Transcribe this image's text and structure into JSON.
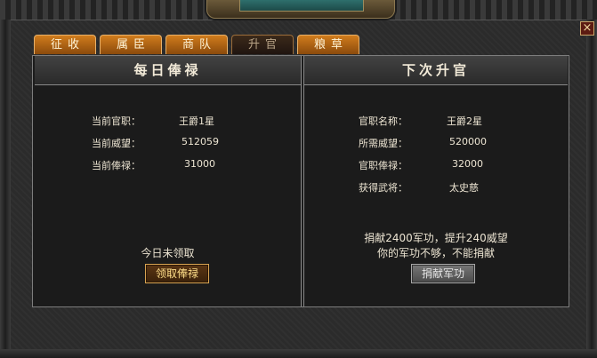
{
  "tabs": [
    {
      "label": "征收",
      "active": false
    },
    {
      "label": "属臣",
      "active": false
    },
    {
      "label": "商队",
      "active": false
    },
    {
      "label": "升官",
      "active": true
    },
    {
      "label": "粮草",
      "active": false
    }
  ],
  "close_symbol": "×",
  "left_panel": {
    "title": "每日俸禄",
    "rows": [
      {
        "label": "当前官职：",
        "value": "王爵1星"
      },
      {
        "label": "当前威望：",
        "value": "512059"
      },
      {
        "label": "当前俸禄：",
        "value": "31000"
      }
    ],
    "status_text": "今日未领取",
    "claim_button": "领取俸禄"
  },
  "right_panel": {
    "title": "下次升官",
    "rows": [
      {
        "label": "官职名称：",
        "value": "王爵2星"
      },
      {
        "label": "所需威望：",
        "value": "520000"
      },
      {
        "label": "官职俸禄：",
        "value": "32000"
      },
      {
        "label": "获得武将：",
        "value": "太史慈"
      }
    ],
    "donate_info": "捐献2400军功，提升240威望",
    "warning": "你的军功不够，不能捐献",
    "donate_button": "捐献军功"
  },
  "colors": {
    "tab_active": "#3b2a1a",
    "tab_inactive": "#d07c1c",
    "claim_button_text": "#ffdf8a",
    "panel_bg": "#1b1b1b"
  }
}
